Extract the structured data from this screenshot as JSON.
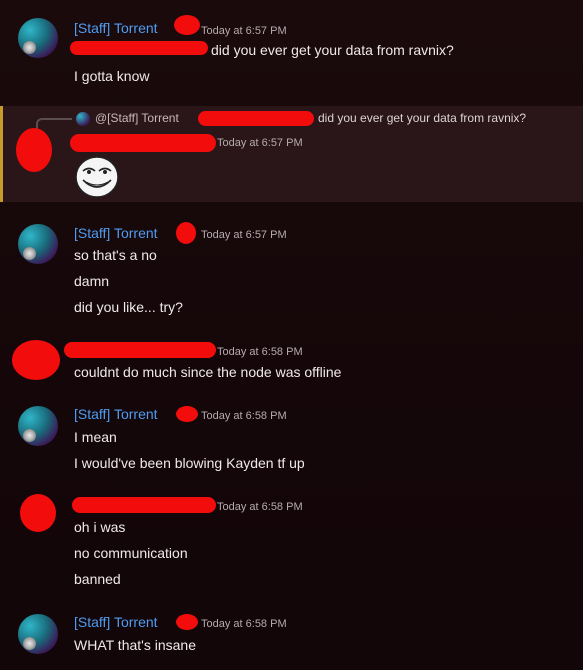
{
  "messages": [
    {
      "author": "[Staff] Torrent",
      "time": "Today at 6:57 PM",
      "lines": [
        "did you ever get your data from ravnix?",
        "I gotta know"
      ]
    },
    {
      "reply_to_author": "@[Staff] Torrent",
      "reply_to_text": "did you ever get your data from ravnix?",
      "time": "Today at 6:57 PM"
    },
    {
      "author": "[Staff] Torrent",
      "time": "Today at 6:57 PM",
      "lines": [
        "so that's a no",
        "damn",
        "did you like... try?"
      ]
    },
    {
      "time": "Today at 6:58 PM",
      "lines": [
        "couldnt do much since the node was offline"
      ]
    },
    {
      "author": "[Staff] Torrent",
      "time": "Today at 6:58 PM",
      "lines": [
        "I mean",
        "I would've been blowing Kayden tf up"
      ]
    },
    {
      "time": "Today at 6:58 PM",
      "lines": [
        "oh i was",
        "no communication",
        "banned"
      ]
    },
    {
      "author": "[Staff] Torrent",
      "time": "Today at 6:58 PM",
      "lines": [
        "WHAT that's insane"
      ]
    }
  ],
  "colors": {
    "author_name": "#4f9cf2",
    "redaction": "#f20c0c",
    "reply_highlight": "#c79a2b"
  },
  "icons": {
    "sticker": "trollface-sticker"
  }
}
